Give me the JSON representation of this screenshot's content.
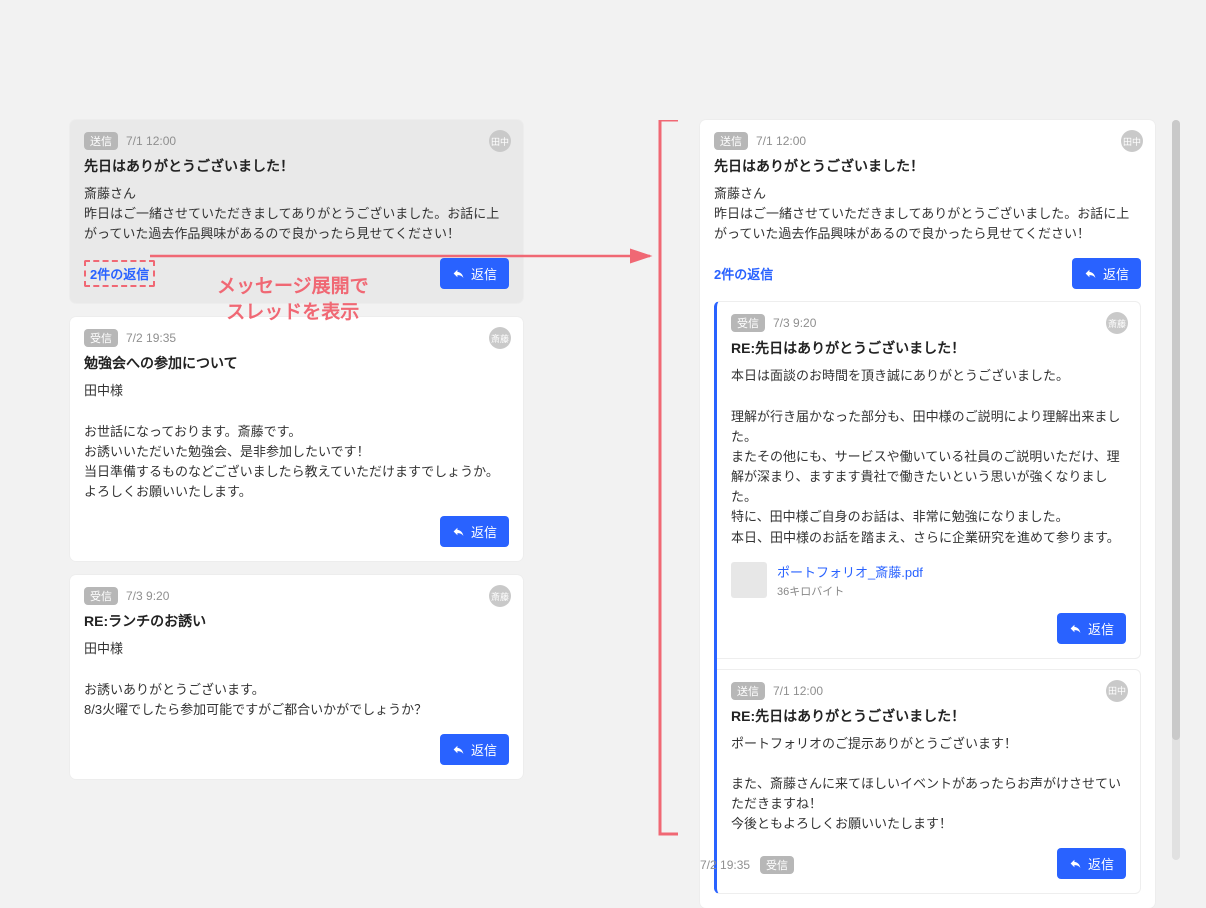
{
  "labels": {
    "send": "送信",
    "recv": "受信",
    "reply": "返信"
  },
  "annotation": "メッセージ展開で\nスレッドを表示",
  "left": {
    "msg1": {
      "badge": "送信",
      "time": "7/1 12:00",
      "avatar": "田中",
      "title": "先日はありがとうございました！",
      "body": "斎藤さん\n昨日はご一緒させていただきましてありがとうございました。お話に上がっていた過去作品興味があるので良かったら見せてください！",
      "thread": "2件の返信"
    },
    "msg2": {
      "badge": "受信",
      "time": "7/2 19:35",
      "avatar": "斎藤",
      "title": "勉強会への参加について",
      "body": "田中様\n\nお世話になっております。斎藤です。\nお誘いいただいた勉強会、是非参加したいです！\n当日準備するものなどございましたら教えていただけますでしょうか。\nよろしくお願いいたします。"
    },
    "msg3": {
      "badge": "受信",
      "time": "7/3 9:20",
      "avatar": "斎藤",
      "title": "RE:ランチのお誘い",
      "body": "田中様\n\nお誘いありがとうございます。\n8/3火曜でしたら参加可能ですがご都合いかがでしょうか？"
    }
  },
  "right": {
    "msg1": {
      "badge": "送信",
      "time": "7/1 12:00",
      "avatar": "田中",
      "title": "先日はありがとうございました！",
      "body": "斎藤さん\n昨日はご一緒させていただきましてありがとうございました。お話に上がっていた過去作品興味があるので良かったら見せてください！",
      "thread": "2件の返信"
    },
    "reply1": {
      "badge": "受信",
      "time": "7/3 9:20",
      "avatar": "斎藤",
      "title": "RE:先日はありがとうございました！",
      "body": "本日は面談のお時間を頂き誠にありがとうございました。\n\n理解が行き届かなった部分も、田中様のご説明により理解出来ました。\nまたその他にも、サービスや働いている社員のご説明いただけ、理解が深まり、ますます貴社で働きたいという思いが強くなりました。\n特に、田中様ご自身のお話は、非常に勉強になりました。\n本日、田中様のお話を踏まえ、さらに企業研究を進めて参ります。",
      "attach_name": "ポートフォリオ_斎藤.pdf",
      "attach_size": "36キロバイト"
    },
    "reply2": {
      "badge": "送信",
      "time": "7/1 12:00",
      "avatar": "田中",
      "title": "RE:先日はありがとうございました！",
      "body": "ポートフォリオのご提示ありがとうございます！\n\nまた、斎藤さんに来てほしいイベントがあったらお声がけさせていただきますね！\n今後ともよろしくお願いいたします！"
    },
    "peek": {
      "time": "7/2 19:35",
      "badge": "受信"
    }
  }
}
